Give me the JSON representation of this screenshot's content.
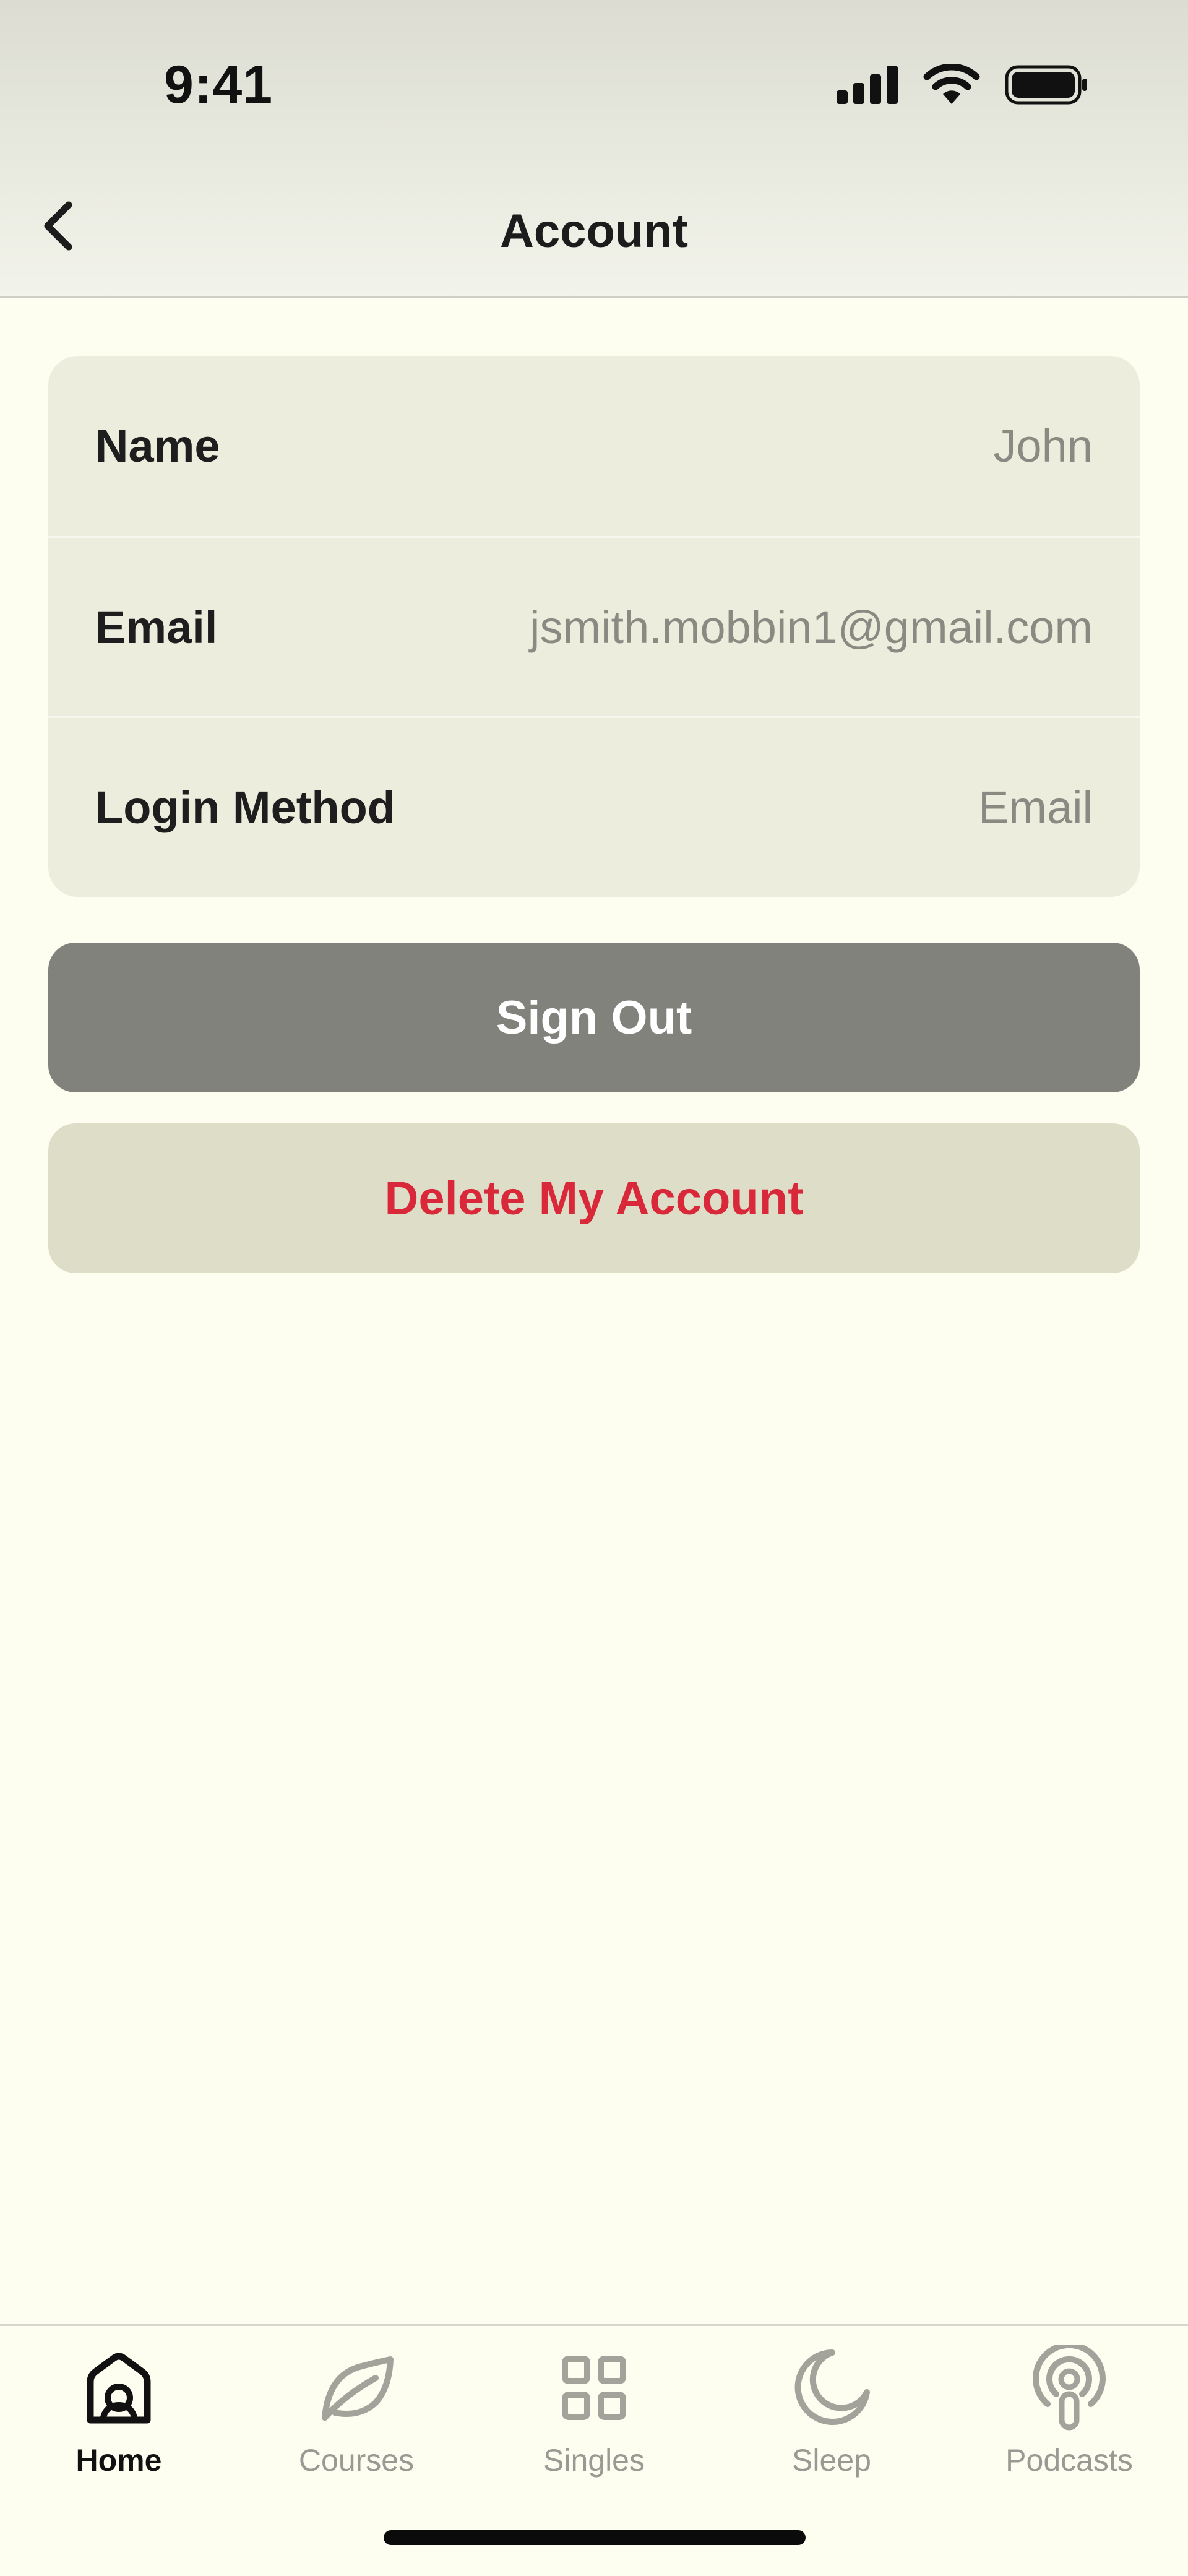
{
  "status_bar": {
    "time": "9:41"
  },
  "header": {
    "title": "Account",
    "back_icon": "chevron-left-icon"
  },
  "account_info": {
    "rows": [
      {
        "label": "Name",
        "value": "John"
      },
      {
        "label": "Email",
        "value": "jsmith.mobbin1@gmail.com"
      },
      {
        "label": "Login Method",
        "value": "Email"
      }
    ]
  },
  "actions": {
    "sign_out_label": "Sign Out",
    "delete_label": "Delete My Account"
  },
  "tab_bar": {
    "active": "Home",
    "items": [
      {
        "label": "Home",
        "icon": "home-icon"
      },
      {
        "label": "Courses",
        "icon": "leaf-icon"
      },
      {
        "label": "Singles",
        "icon": "grid-icon"
      },
      {
        "label": "Sleep",
        "icon": "moon-icon"
      },
      {
        "label": "Podcasts",
        "icon": "podcast-icon"
      }
    ]
  },
  "colors": {
    "background": "#FDFDF0",
    "card": "#EDEDDD",
    "sign_out_bg": "#82827D",
    "delete_bg": "#DEDEC8",
    "delete_text": "#D9283A",
    "inactive_tab": "#9A9A94"
  }
}
